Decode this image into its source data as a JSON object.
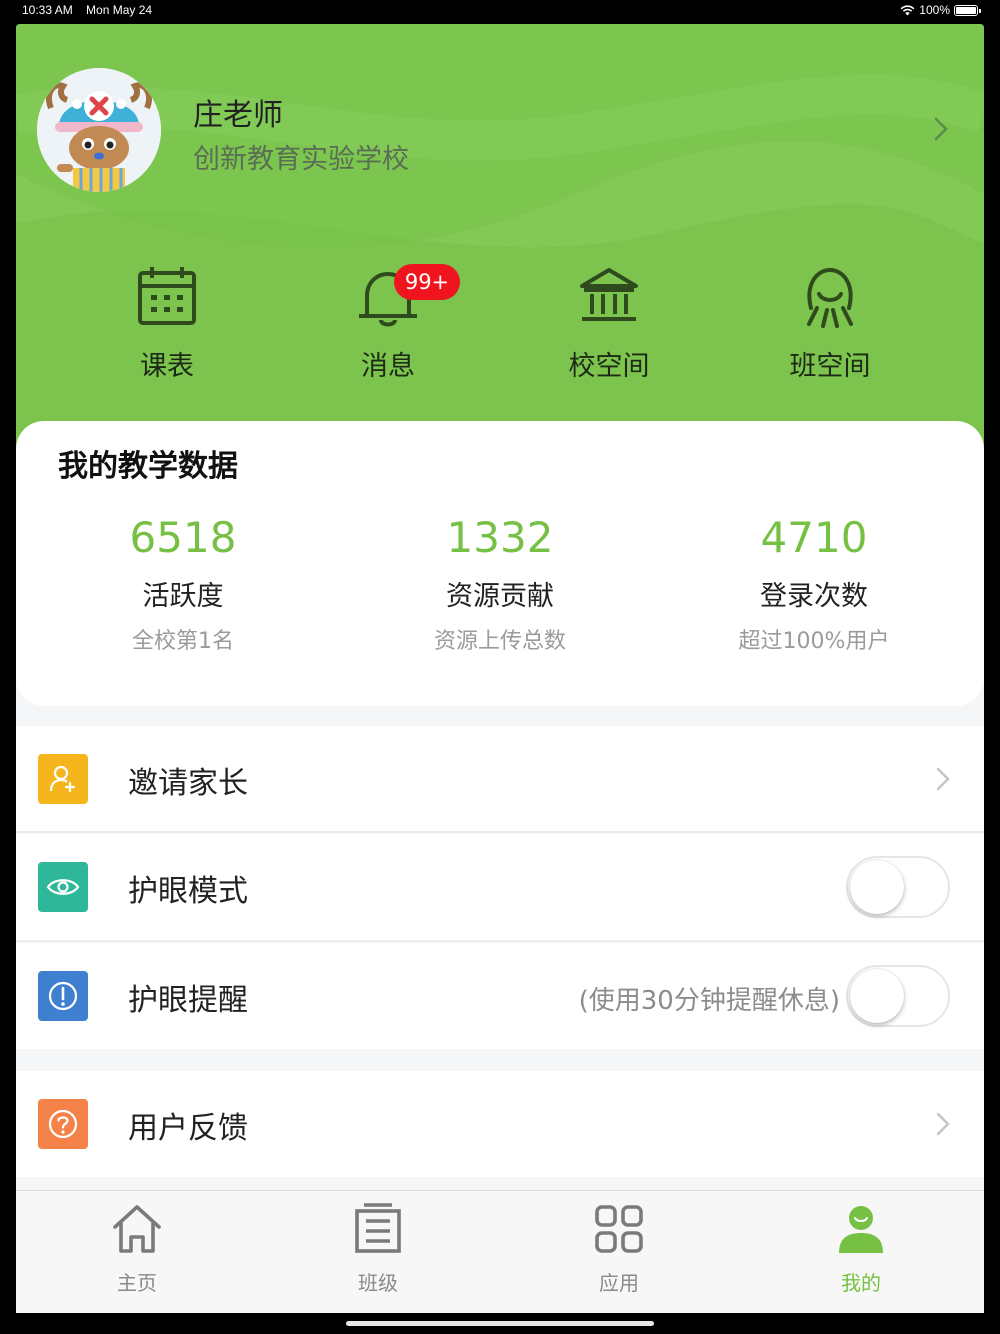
{
  "status_bar": {
    "time": "10:33 AM",
    "date": "Mon May 24",
    "battery": "100%"
  },
  "profile": {
    "name": "庄老师",
    "school": "创新教育实验学校"
  },
  "quick_actions": [
    {
      "label": "课表",
      "icon": "calendar-icon"
    },
    {
      "label": "消息",
      "icon": "bell-icon",
      "badge": "99+"
    },
    {
      "label": "校空间",
      "icon": "school-building-icon"
    },
    {
      "label": "班空间",
      "icon": "class-space-icon"
    }
  ],
  "teaching_data": {
    "title": "我的教学数据",
    "stats": [
      {
        "value": "6518",
        "name": "活跃度",
        "desc": "全校第1名"
      },
      {
        "value": "1332",
        "name": "资源贡献",
        "desc": "资源上传总数"
      },
      {
        "value": "4710",
        "name": "登录次数",
        "desc": "超过100%用户"
      }
    ]
  },
  "settings": [
    {
      "label": "邀请家长",
      "icon": "invite-user-icon",
      "icon_color": "#f5b51c",
      "control": "chevron"
    },
    {
      "label": "护眼模式",
      "icon": "eye-icon",
      "icon_color": "#2fb79a",
      "control": "toggle",
      "on": false
    },
    {
      "label": "护眼提醒",
      "icon": "alert-icon",
      "icon_color": "#3f7fd0",
      "control": "toggle",
      "on": false,
      "hint": "(使用30分钟提醒休息)"
    },
    {
      "label": "用户反馈",
      "icon": "question-icon",
      "icon_color": "#f58349",
      "control": "chevron"
    }
  ],
  "tabs": [
    {
      "label": "主页",
      "icon": "home-icon",
      "active": false
    },
    {
      "label": "班级",
      "icon": "class-icon",
      "active": false
    },
    {
      "label": "应用",
      "icon": "apps-icon",
      "active": false
    },
    {
      "label": "我的",
      "icon": "profile-icon",
      "active": true
    }
  ],
  "colors": {
    "header_green": "#7cc64f",
    "accent_green": "#76c043",
    "badge_red": "#f0141e"
  }
}
